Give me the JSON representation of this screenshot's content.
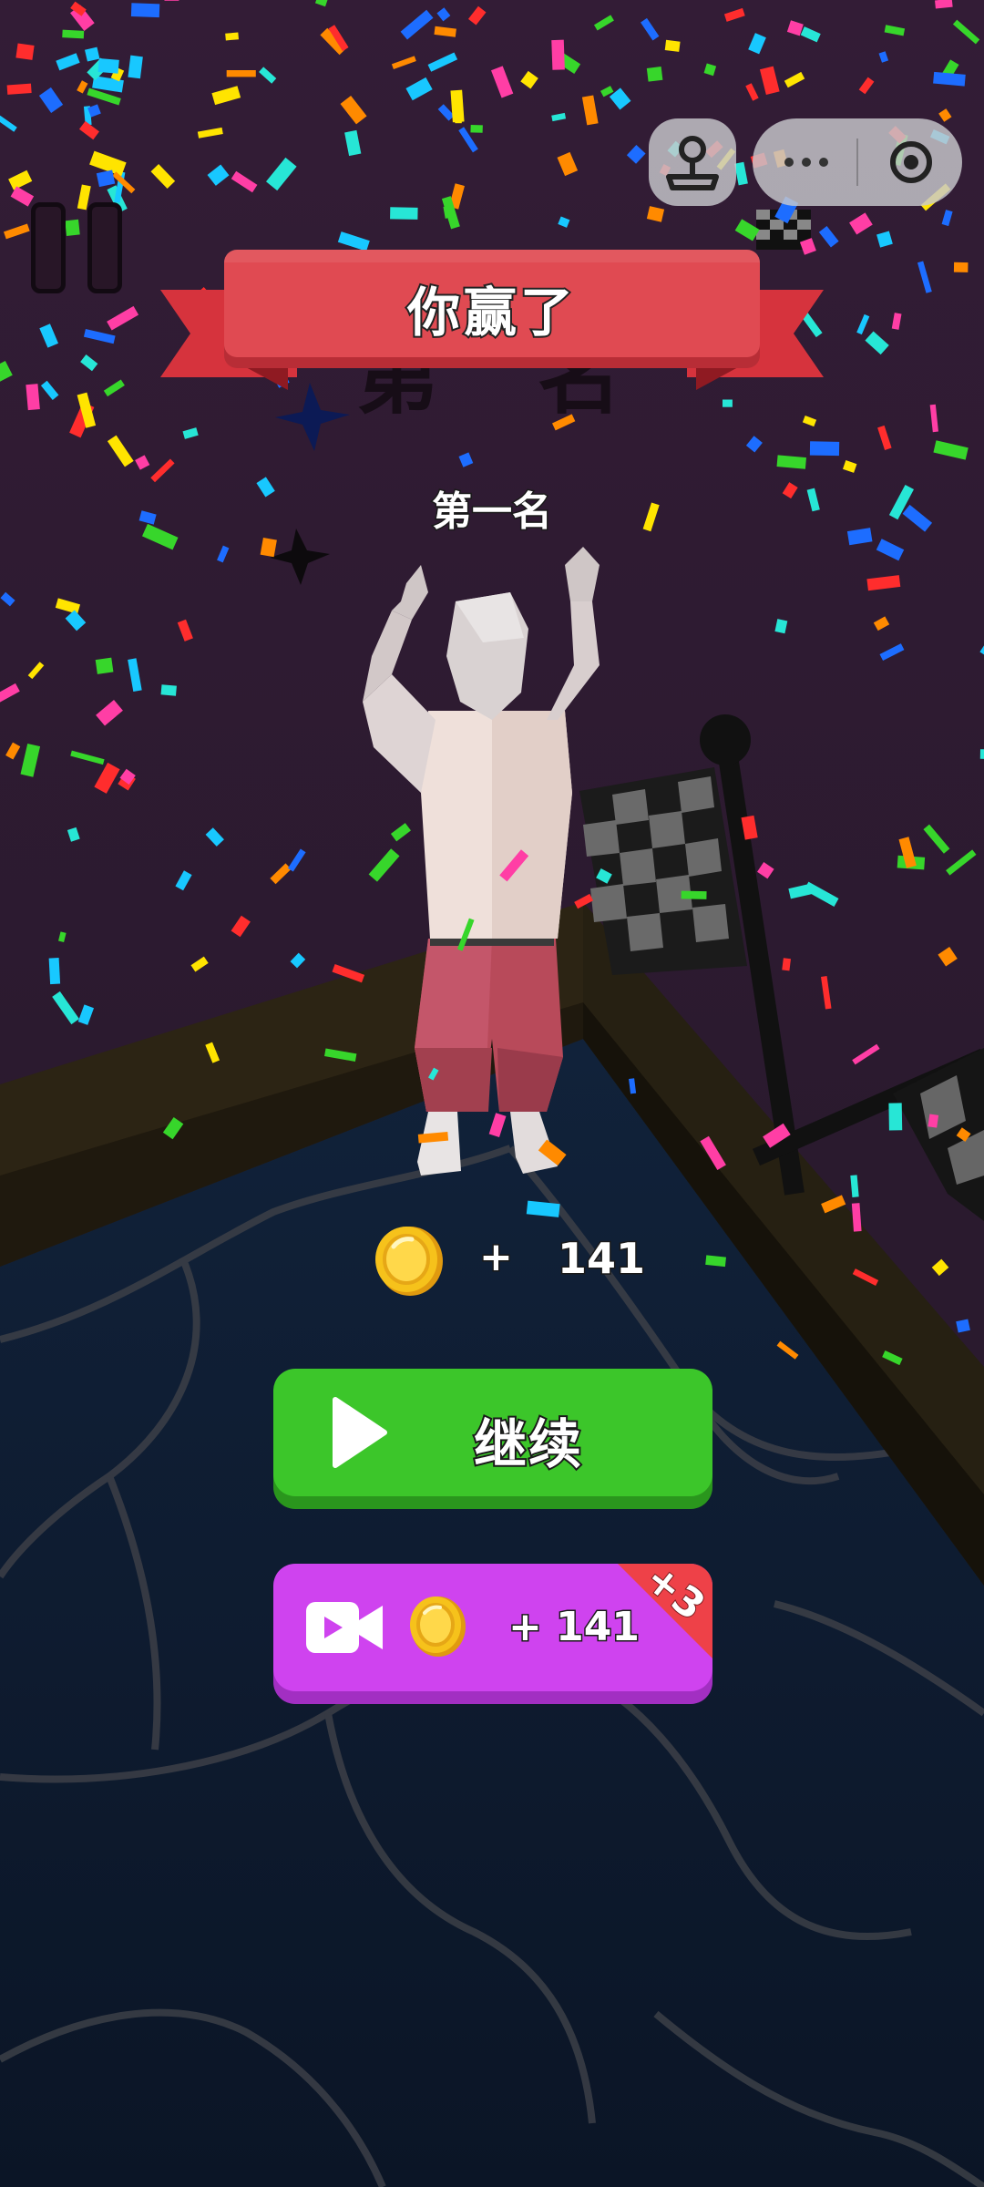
{
  "banner": {
    "title": "你赢了"
  },
  "result": {
    "rank_label": "第一名"
  },
  "reward": {
    "plus": "+",
    "amount": "141",
    "icon": "gold-coin-icon"
  },
  "buttons": {
    "continue": {
      "label": "继续",
      "icon": "play-icon"
    },
    "video_reward": {
      "plus_amount": "+ 141",
      "bonus_badge": "+3",
      "icon": "video-camera-icon"
    }
  },
  "top_bar": {
    "pause_icon": "pause-icon",
    "game_center_icon": "joystick-icon",
    "more_icon": "more-dots-icon",
    "close_icon": "target-close-icon"
  },
  "colors": {
    "banner": "#e04a52",
    "continue_button": "#3cc62a",
    "video_button": "#cf43ef",
    "bonus_ribbon": "#ee4148",
    "coin": "#f6c21b",
    "sky": "#2c1a30",
    "water": "#0f1e33"
  }
}
